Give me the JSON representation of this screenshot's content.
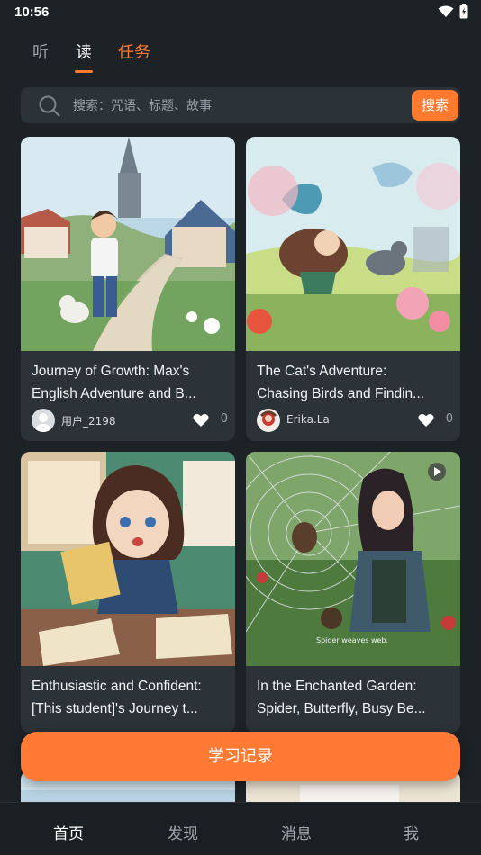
{
  "status": {
    "time": "10:56"
  },
  "tabs": [
    {
      "label": "听"
    },
    {
      "label": "读"
    },
    {
      "label": "任务"
    }
  ],
  "search": {
    "placeholder": "搜索：咒语、标题、故事",
    "button": "搜索"
  },
  "cards": [
    {
      "title1": "Journey of Growth: Max's",
      "title2": "English Adventure and B...",
      "author": "用户_2198",
      "likes": "0"
    },
    {
      "title1": "The Cat's Adventure:",
      "title2": "Chasing Birds and Findin...",
      "author": "Erika.La",
      "likes": "0"
    },
    {
      "title1": "Enthusiastic and Confident:",
      "title2": "[This student]'s Journey t..."
    },
    {
      "title1": "In the Enchanted Garden:",
      "title2": "Spider, Butterfly, Busy Be...",
      "img_caption": "Spider weaves web."
    }
  ],
  "fab": {
    "label": "学习记录"
  },
  "nav": [
    {
      "label": "首页"
    },
    {
      "label": "发现"
    },
    {
      "label": "消息"
    },
    {
      "label": "我"
    }
  ],
  "colors": {
    "accent": "#ff7a2f",
    "background": "#1d2227",
    "card": "#2b3238"
  }
}
